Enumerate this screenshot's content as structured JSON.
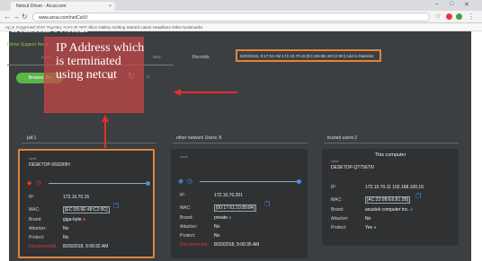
{
  "browser": {
    "tab_title": "Netcut Driver - Arcai.com",
    "close_glyph": "×",
    "url": "www.arcai.com/netCutV/",
    "bookmarks": "Apps  Suggested Sites  Imported From IE  Web Slice Gallery  Getting Started  Latest Headlines  Other bookmarks"
  },
  "app": {
    "title": "Arcai.com's Netcut",
    "subtitle": "Home  Support  News",
    "headers": {
      "name": "name",
      "ip": "IP",
      "mac": "MAC",
      "records_label": "Records"
    },
    "records_value": "8/20/2018, 9:17:02 AM 172.10.70.15 [EC:D5:9E:48:C2:9C] Add to blacklist",
    "browse_button": "Browse On",
    "colors": {
      "background": "#3c3f41",
      "card": "#2f3133",
      "highlight": "#e0853a",
      "accent_green": "#5bb547",
      "accent_blue": "#4a90e2",
      "alert_red": "#e53935"
    }
  },
  "columns": {
    "jail_header": "jail:1",
    "other_header": "other network Users: 8",
    "trusted_header": "trusted users:2"
  },
  "cards": {
    "jail": {
      "name_label": "name",
      "name": "DESKTOP-06SDI9H",
      "ip_key": "IP:",
      "ip": "172.10.70.15",
      "mac_key": "MAC:",
      "mac": "[EC:D5:9E:48:C2:9C]",
      "brand_key": "Brand:",
      "brand": "giga-byte",
      "attacker_key": "Attacker:",
      "attacker": "No",
      "protect_key": "Protect:",
      "protect": "No",
      "status": "Disconnected",
      "timestamp": "8/20/2018, 9:09:32 AM"
    },
    "other": {
      "name_label": "name",
      "name": "",
      "ip_key": "IP:",
      "ip": "172.10.70.201",
      "mac_key": "MAC:",
      "mac": "[00:17:61:10:89:84]",
      "brand_key": "Brand:",
      "brand": "private",
      "attacker_key": "Attacker:",
      "attacker": "No",
      "protect_key": "Protect:",
      "protect": "No",
      "status": "Disconnected",
      "timestamp": "8/20/2018, 9:09:35 AM"
    },
    "trusted": {
      "this_computer": "This computer",
      "name_label": "name",
      "name": "DESKTOP-QT7567IV",
      "ip_key": "IP:",
      "ip": "172.10.70.11 192.168.100.15",
      "mac_key": "MAC:",
      "mac": "[AC:22:0B:E6:81:2B]",
      "brand_key": "Brand:",
      "brand": "asustek computer inc.",
      "attacker_key": "Attacker:",
      "attacker": "No",
      "protect_key": "Protect:",
      "protect": "Yes"
    }
  },
  "annotation": {
    "text": "IP Address which is terminated using netcut"
  },
  "icons": [
    "back-arrow-icon",
    "forward-arrow-icon",
    "reload-icon",
    "star-icon",
    "pause-icon",
    "refresh-icon",
    "search-icon",
    "shield-icon",
    "clock-icon",
    "wifi-icon",
    "copy-icon"
  ]
}
